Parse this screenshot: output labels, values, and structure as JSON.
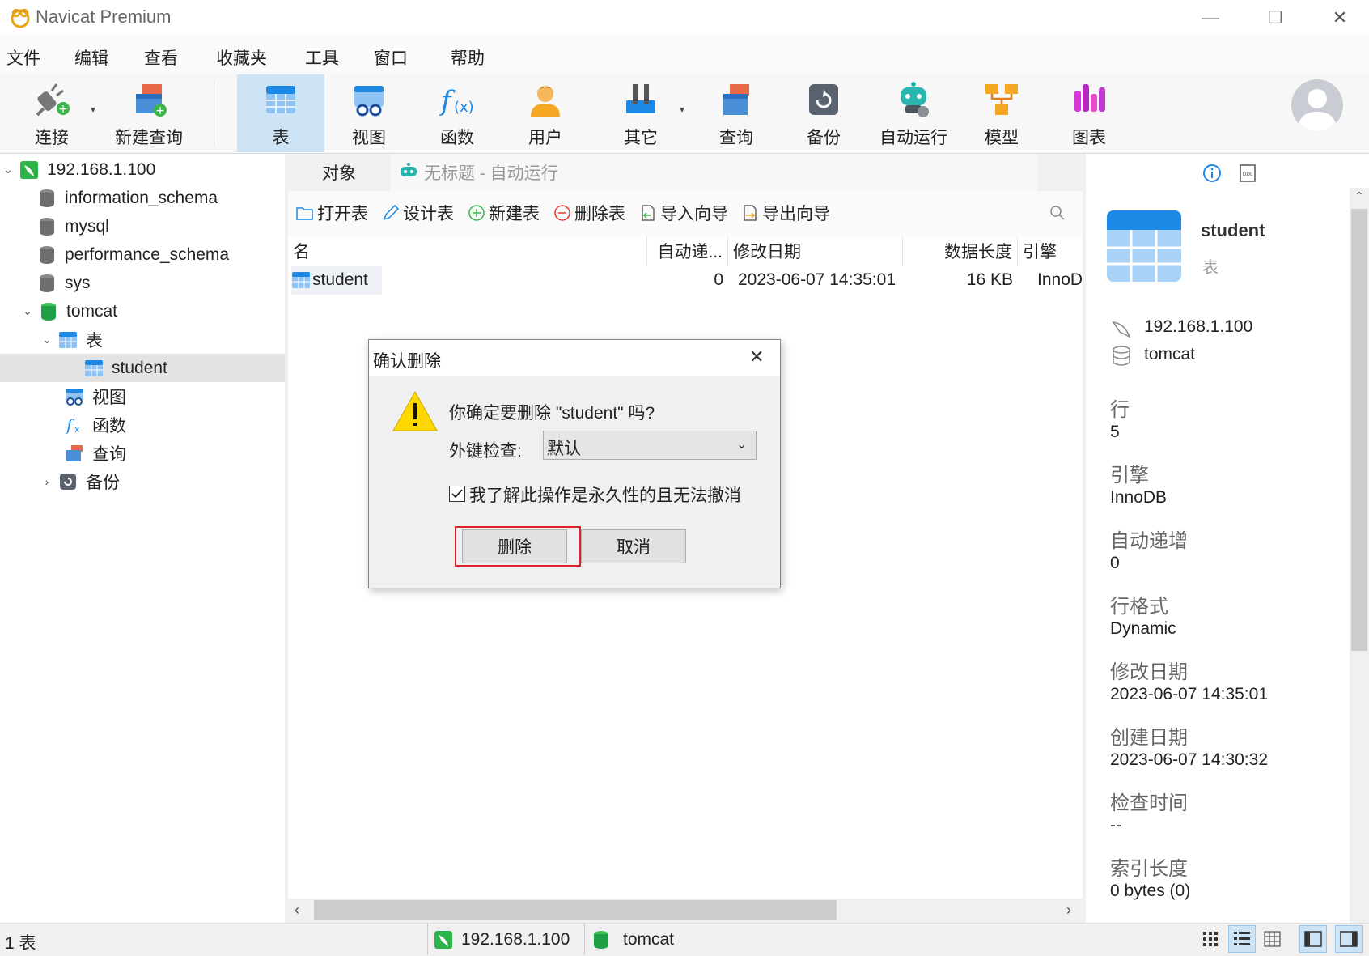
{
  "window": {
    "title": "Navicat Premium",
    "minimize": "—",
    "maximize": "☐",
    "close": "✕"
  },
  "menu": [
    "文件",
    "编辑",
    "查看",
    "收藏夹",
    "工具",
    "窗口",
    "帮助"
  ],
  "toolbar": {
    "connect": "连接",
    "new_query": "新建查询",
    "table": "表",
    "view": "视图",
    "function": "函数",
    "user": "用户",
    "other": "其它",
    "query": "查询",
    "backup": "备份",
    "automation": "自动运行",
    "model": "模型",
    "chart": "图表"
  },
  "tree": {
    "connection": "192.168.1.100",
    "databases": [
      "information_schema",
      "mysql",
      "performance_schema",
      "sys"
    ],
    "tomcat": "tomcat",
    "tables_node": "表",
    "student": "student",
    "views_node": "视图",
    "functions_node": "函数",
    "queries_node": "查询",
    "backups_node": "备份"
  },
  "tabs": {
    "objects": "对象",
    "untitled": "无标题 - 自动运行"
  },
  "objbar": {
    "open_table": "打开表",
    "design_table": "设计表",
    "new_table": "新建表",
    "delete_table": "删除表",
    "import_wizard": "导入向导",
    "export_wizard": "导出向导"
  },
  "list": {
    "headers": {
      "name": "名",
      "auto_inc": "自动递...",
      "modified": "修改日期",
      "data_length": "数据长度",
      "engine": "引擎"
    },
    "rows": [
      {
        "name": "student",
        "auto_inc": "0",
        "modified": "2023-06-07 14:35:01",
        "data_length": "16 KB",
        "engine": "InnoD"
      }
    ]
  },
  "info": {
    "name": "student",
    "type": "表",
    "host": "192.168.1.100",
    "database": "tomcat",
    "rows_label": "行",
    "rows_value": "5",
    "engine_label": "引擎",
    "engine_value": "InnoDB",
    "auto_inc_label": "自动递增",
    "auto_inc_value": "0",
    "row_format_label": "行格式",
    "row_format_value": "Dynamic",
    "modified_label": "修改日期",
    "modified_value": "2023-06-07 14:35:01",
    "created_label": "创建日期",
    "created_value": "2023-06-07 14:30:32",
    "checked_label": "检查时间",
    "checked_value": "--",
    "index_len_label": "索引长度",
    "index_len_value": "0 bytes (0)"
  },
  "status": {
    "count": "1 表",
    "connection": "192.168.1.100",
    "database": "tomcat"
  },
  "dialog": {
    "title": "确认删除",
    "message": "你确定要删除 \"student\" 吗?",
    "fk_label": "外键检查:",
    "fk_value": "默认",
    "checkbox_label": "我了解此操作是永久性的且无法撤消",
    "delete_button": "删除",
    "cancel_button": "取消"
  },
  "colors": {
    "accent": "#1e88e5",
    "highlight_border": "#e0202a",
    "selected_tool": "#cde4f7"
  }
}
